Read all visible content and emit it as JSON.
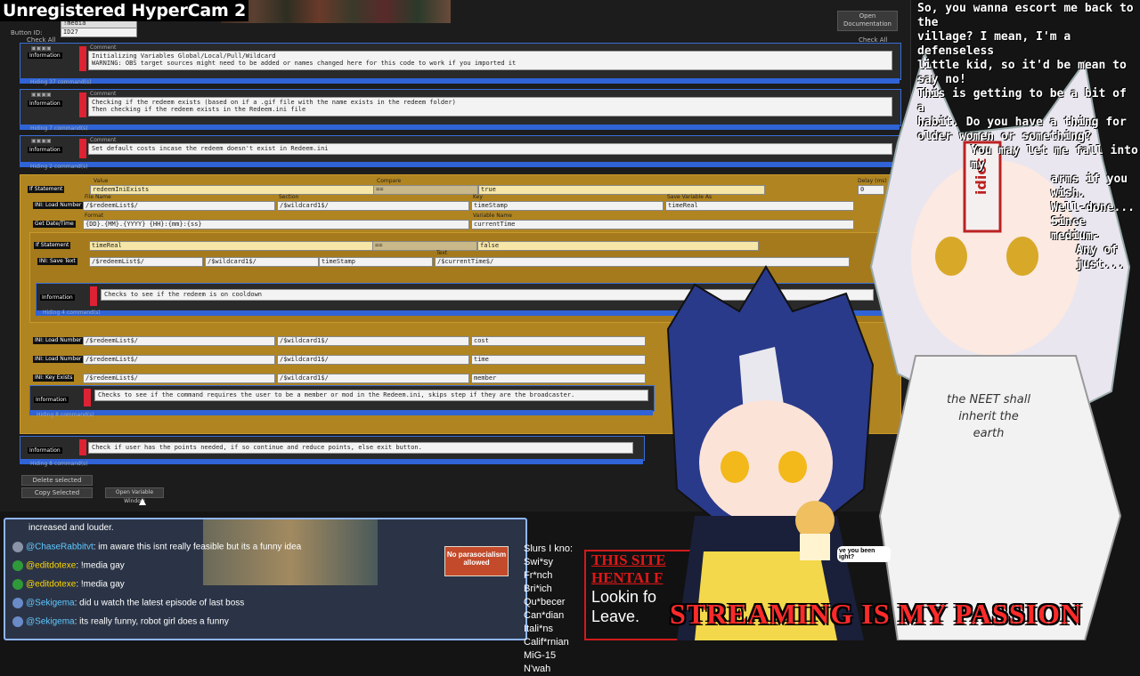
{
  "watermark": "Unregistered HyperCam 2",
  "editor": {
    "button_id_label": "Button ID:",
    "button_id_value": "ID27",
    "title_field": "!media",
    "check_all_left": "Check All",
    "check_all_right": "Check All",
    "open_doc_button": "Open Documentation",
    "blocks": [
      {
        "tag": "Information",
        "comment_header": "Comment",
        "lines": "Initializing Variables Global/Local/Pull/Wildcard\nWARNING: OBS target sources might need to be added or names changed here for this code to work if you imported it",
        "hiding": "Hiding 37 command(s)"
      },
      {
        "tag": "Information",
        "comment_header": "Comment",
        "lines": "Checking if the redeem exists (based on if a .gif file with the name exists in the redeem folder)\nThen checking if the redeem exists in the Redeem.ini file",
        "hiding": "Hiding 7 command(s)"
      },
      {
        "tag": "Information",
        "comment_header": "Comment",
        "lines": "Set default costs incase the redeem doesn't exist in Redeem.ini",
        "hiding": "Hiding 2 command(s)"
      }
    ],
    "if1": {
      "tag": "If Statement",
      "value_header": "Value",
      "compare_header": "Compare",
      "value1": "redeemIniExists",
      "compare": "==",
      "value2": "true",
      "delay_header": "Delay (ms)",
      "delay": "0"
    },
    "load1": {
      "tag": "INI: Load Number",
      "file_header": "File Name",
      "section_header": "Section",
      "key_header": "Key",
      "save_header": "Save Variable As",
      "file": "/$redeemList$/",
      "section": "/$wildcard1$/",
      "key": "timeStamp",
      "save": "timeReal"
    },
    "getdate": {
      "tag": "Get Date/Time",
      "format_header": "Format",
      "var_header": "Variable Name",
      "format": "{DD}.{MM}.{YYYY} {HH}:{mm}:{ss}",
      "var": "currentTime"
    },
    "if2": {
      "tag": "If Statement",
      "value1": "timeReal",
      "compare": "==",
      "value2": "false"
    },
    "save1": {
      "tag": "INI: Save Text",
      "file": "/$redeemList$/",
      "section": "/$wildcard1$/",
      "key": "timeStamp",
      "text_header": "Text",
      "text": "/$currentTime$/"
    },
    "cooldown": {
      "tag": "Information",
      "lines": "Checks to see if the redeem is on cooldown",
      "hiding": "Hiding 4 command(s)"
    },
    "load2": {
      "tag": "INI: Load Number",
      "file": "/$redeemList$/",
      "section": "/$wildcard1$/",
      "key": "cost",
      "save_header": "Value As"
    },
    "load3": {
      "tag": "INI: Load Number",
      "file": "/$redeemList$/",
      "section": "/$wildcard1$/",
      "key": "time"
    },
    "keyexists": {
      "tag": "INI: Key Exists",
      "file": "/$redeemList$/",
      "section": "/$wildcard1$/",
      "key": "member"
    },
    "member_check": {
      "tag": "Information",
      "lines": "Checks to see if the command requires the user to be a member or mod in the Redeem.ini, skips step if they are the broadcaster.",
      "hiding": "Hiding 8 command(s)"
    },
    "points_check": {
      "tag": "Information",
      "lines": "Check if user has the points needed, if so continue and reduce points, else exit button.",
      "hiding": "Hiding 8 command(s)"
    },
    "delete_selected": "Delete selected",
    "copy_selected": "Copy Selected",
    "open_variable_window": "Open Variable Window"
  },
  "overlay_text": {
    "lines": [
      "So, you wanna escort me back to the",
      "village? I mean, I'm a defenseless",
      "little kid, so it'd be mean to say no!",
      "This is getting to be a bit of a",
      "habit. Do you have a thing for",
      "older women or something?",
      "You may let me fall into my",
      "arms if you wish.",
      "Well-done...",
      "Since medium-",
      "Any of",
      "just..."
    ]
  },
  "chat": {
    "lines": [
      {
        "name": "",
        "text": "increased and louder."
      },
      {
        "name": "@ChaseRabbitvt",
        "text": ": im aware this isnt really feasible but its a funny idea"
      },
      {
        "name": "@editdotexe",
        "text": ": !media gay"
      },
      {
        "name": "@editdotexe",
        "text": ": !media gay"
      },
      {
        "name": "@Sekigema",
        "text": ": did u watch the latest episode of last boss"
      },
      {
        "name": "@Sekigema",
        "text": ": its really funny, robot girl does a funny"
      }
    ],
    "sign": "No parasocialism allowed"
  },
  "slurs": [
    "Slurs I kno:",
    "Swi*sy",
    "Fr*nch",
    "Bri*ich",
    "Qu*becer",
    "Can*dian",
    "Itali*ns",
    "Calif*rnian",
    "MiG-15",
    "N'wah"
  ],
  "hentai_sign": {
    "red1": "THIS SITE",
    "red2": "HENTAI F",
    "white1": "Lookin fo",
    "white2": "Leave."
  },
  "tshirt": {
    "l1": "the NEET shall",
    "l2": "inherit the",
    "l3": "earth"
  },
  "headband": "idiot",
  "mini_bubble": "ve you been ight?",
  "streaming_banner": "STREAMING IS MY PASSION",
  "colors": {
    "accent_blue": "#2f63d6",
    "gold": "#b08420",
    "banner_red": "#ff2a2a"
  }
}
